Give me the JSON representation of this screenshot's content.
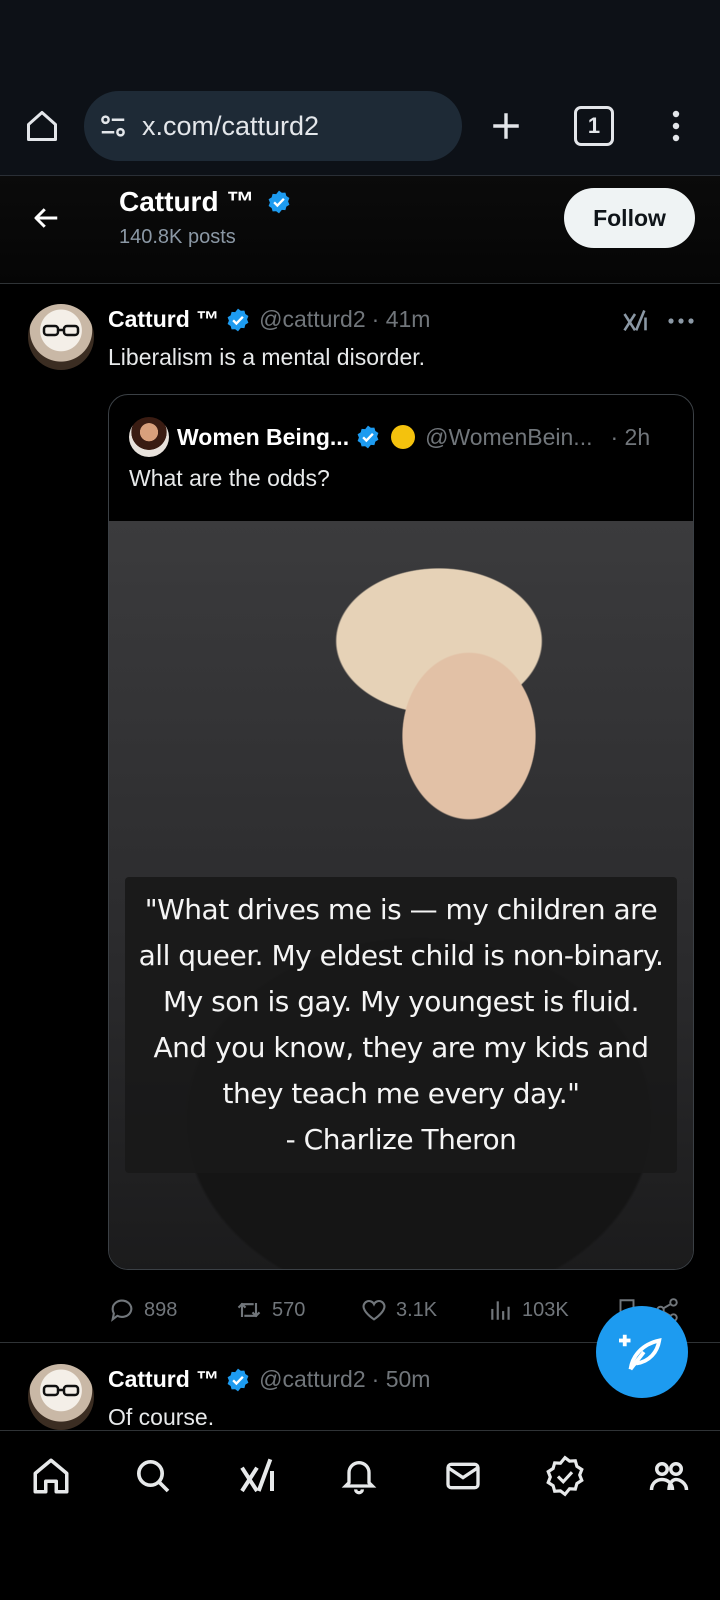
{
  "browser": {
    "url": "x.com/catturd2",
    "tab_count": "1"
  },
  "profile_header": {
    "name": "Catturd ™",
    "posts_count": "140.8K posts",
    "follow_label": "Follow"
  },
  "post1": {
    "author": "Catturd ™",
    "handle": "@catturd2",
    "time": "· 41m",
    "text": "Liberalism is a mental disorder.",
    "quote": {
      "author": "Women Being...",
      "handle": "@WomenBein...",
      "time": "· 2h",
      "text": "What are the odds?",
      "image_caption": [
        "\"What drives me is — my children are",
        "all queer. My eldest child is non-binary.",
        "My son is gay. My youngest is fluid.",
        "And you know, they are my kids and",
        "they teach me every day.\"",
        "- Charlize Theron"
      ]
    },
    "stats": {
      "replies": "898",
      "reposts": "570",
      "likes": "3.1K",
      "views": "103K"
    }
  },
  "post2": {
    "author": "Catturd ™",
    "handle": "@catturd2",
    "time": "· 50m",
    "text": "Of course."
  },
  "bottom_nav": [
    "home-icon",
    "search-icon",
    "grok-icon",
    "notifications-icon",
    "messages-icon",
    "verified-icon",
    "communities-icon"
  ],
  "colors": {
    "accent": "#1d9bf0",
    "background": "#000000",
    "muted": "#71767b"
  }
}
